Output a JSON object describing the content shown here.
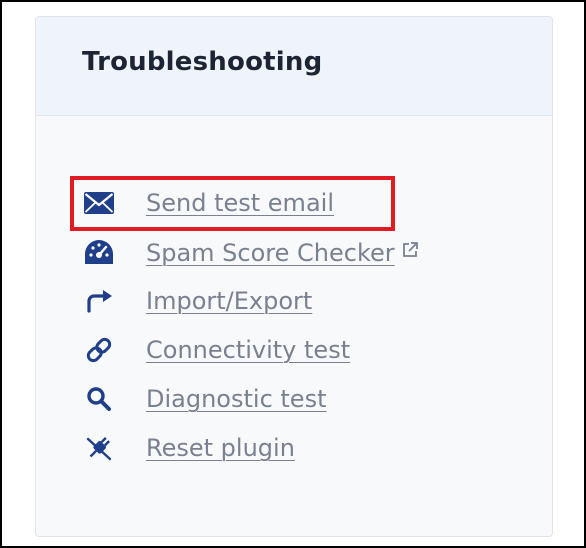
{
  "panel": {
    "title": "Troubleshooting",
    "items": [
      {
        "label": "Send test email",
        "icon": "envelope-icon",
        "highlighted": true
      },
      {
        "label": "Spam Score Checker",
        "icon": "gauge-icon",
        "external": true,
        "external_icon": "external-link-icon"
      },
      {
        "label": "Import/Export",
        "icon": "arrow-redo-icon"
      },
      {
        "label": "Connectivity test",
        "icon": "link-icon"
      },
      {
        "label": "Diagnostic test",
        "icon": "magnifier-icon"
      },
      {
        "label": "Reset plugin",
        "icon": "unplug-icon"
      }
    ]
  },
  "colors": {
    "icon": "#1f3f8a",
    "link": "#7b8091",
    "highlight": "#e11b22",
    "header_bg": "#eff3fa",
    "card_bg": "#f8f9fb"
  }
}
